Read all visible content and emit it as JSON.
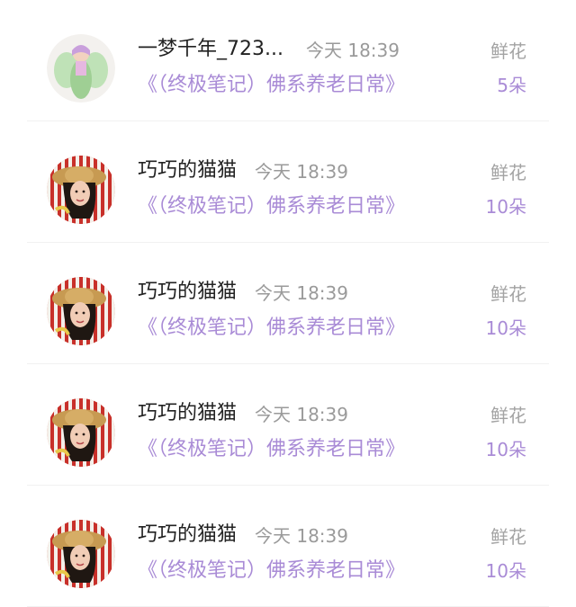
{
  "gifts": [
    {
      "user": "一梦千年_723...",
      "time": "今天 18:39",
      "book": "《（终极笔记）佛系养老日常》",
      "gift_type": "鲜花",
      "gift_count": "5朵",
      "avatar": "fairy-avatar"
    },
    {
      "user": "巧巧的猫猫",
      "time": "今天 18:39",
      "book": "《（终极笔记）佛系养老日常》",
      "gift_type": "鲜花",
      "gift_count": "10朵",
      "avatar": "woman-hat-avatar"
    },
    {
      "user": "巧巧的猫猫",
      "time": "今天 18:39",
      "book": "《（终极笔记）佛系养老日常》",
      "gift_type": "鲜花",
      "gift_count": "10朵",
      "avatar": "woman-hat-avatar"
    },
    {
      "user": "巧巧的猫猫",
      "time": "今天 18:39",
      "book": "《（终极笔记）佛系养老日常》",
      "gift_type": "鲜花",
      "gift_count": "10朵",
      "avatar": "woman-hat-avatar"
    },
    {
      "user": "巧巧的猫猫",
      "time": "今天 18:39",
      "book": "《（终极笔记）佛系养老日常》",
      "gift_type": "鲜花",
      "gift_count": "10朵",
      "avatar": "woman-hat-avatar"
    }
  ]
}
